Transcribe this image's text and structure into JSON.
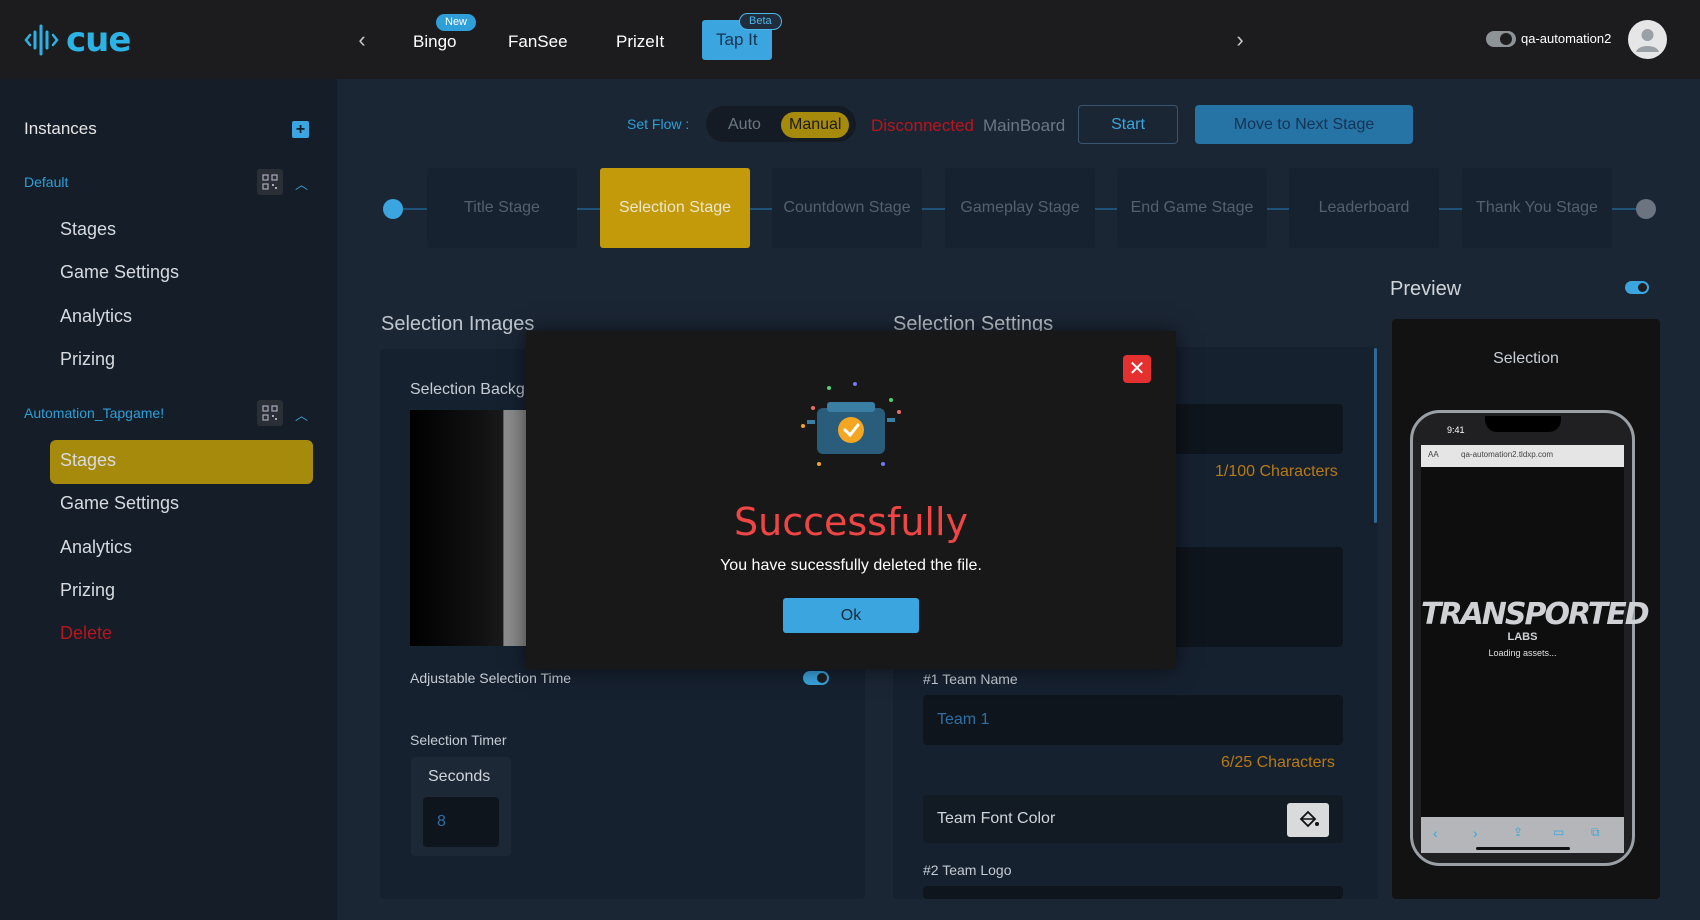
{
  "header": {
    "logo_text": "cue",
    "tabs": [
      {
        "label": "Bingo",
        "badge": "New"
      },
      {
        "label": "FanSee"
      },
      {
        "label": "PrizeIt"
      },
      {
        "label": "Tap It",
        "badge": "Beta"
      }
    ],
    "user_name": "qa-automation2"
  },
  "sidebar": {
    "title": "Instances",
    "groups": [
      {
        "name": "Default",
        "items": [
          "Stages",
          "Game Settings",
          "Analytics",
          "Prizing"
        ]
      },
      {
        "name": "Automation_Tapgame!",
        "items": [
          "Stages",
          "Game Settings",
          "Analytics",
          "Prizing",
          "Delete"
        ]
      }
    ]
  },
  "controls": {
    "set_flow_label": "Set Flow :",
    "flow_auto": "Auto",
    "flow_manual": "Manual",
    "status": "Disconnected",
    "board": "MainBoard",
    "start": "Start",
    "next_stage": "Move to Next Stage"
  },
  "stages": [
    "Title Stage",
    "Selection Stage",
    "Countdown Stage",
    "Gameplay Stage",
    "End Game Stage",
    "Leaderboard",
    "Thank You Stage"
  ],
  "active_stage": "Selection Stage",
  "selection_images": {
    "title": "Selection Images",
    "background_label": "Selection Backg",
    "adjustable_label": "Adjustable Selection Time",
    "timer_label": "Selection Timer",
    "seconds_label": "Seconds",
    "seconds_value": "8"
  },
  "selection_settings": {
    "title": "Selection Settings",
    "char_count_1": "1/100 Characters",
    "team1_label": "#1 Team Name",
    "team1_value": "Team 1",
    "team1_count": "6/25 Characters",
    "font_color_label": "Team Font Color",
    "team2_logo_label": "#2 Team Logo"
  },
  "preview": {
    "title": "Preview",
    "screen_title": "Selection",
    "phone_time": "9:41",
    "phone_url": "qa-automation2.tldxp.com",
    "phone_aa": "AA",
    "brand_big": "TRANSPORTED",
    "brand_small": "LABS",
    "loading_text": "Loading assets..."
  },
  "modal": {
    "title": "Successfully",
    "message": "You have sucessfully deleted the file.",
    "ok_label": "Ok"
  },
  "colors": {
    "accent_blue": "#3aa5de",
    "accent_gold": "#c29a0a",
    "error_red": "#e53030",
    "status_red": "#b8151d",
    "hint_orange": "#b77a14"
  }
}
